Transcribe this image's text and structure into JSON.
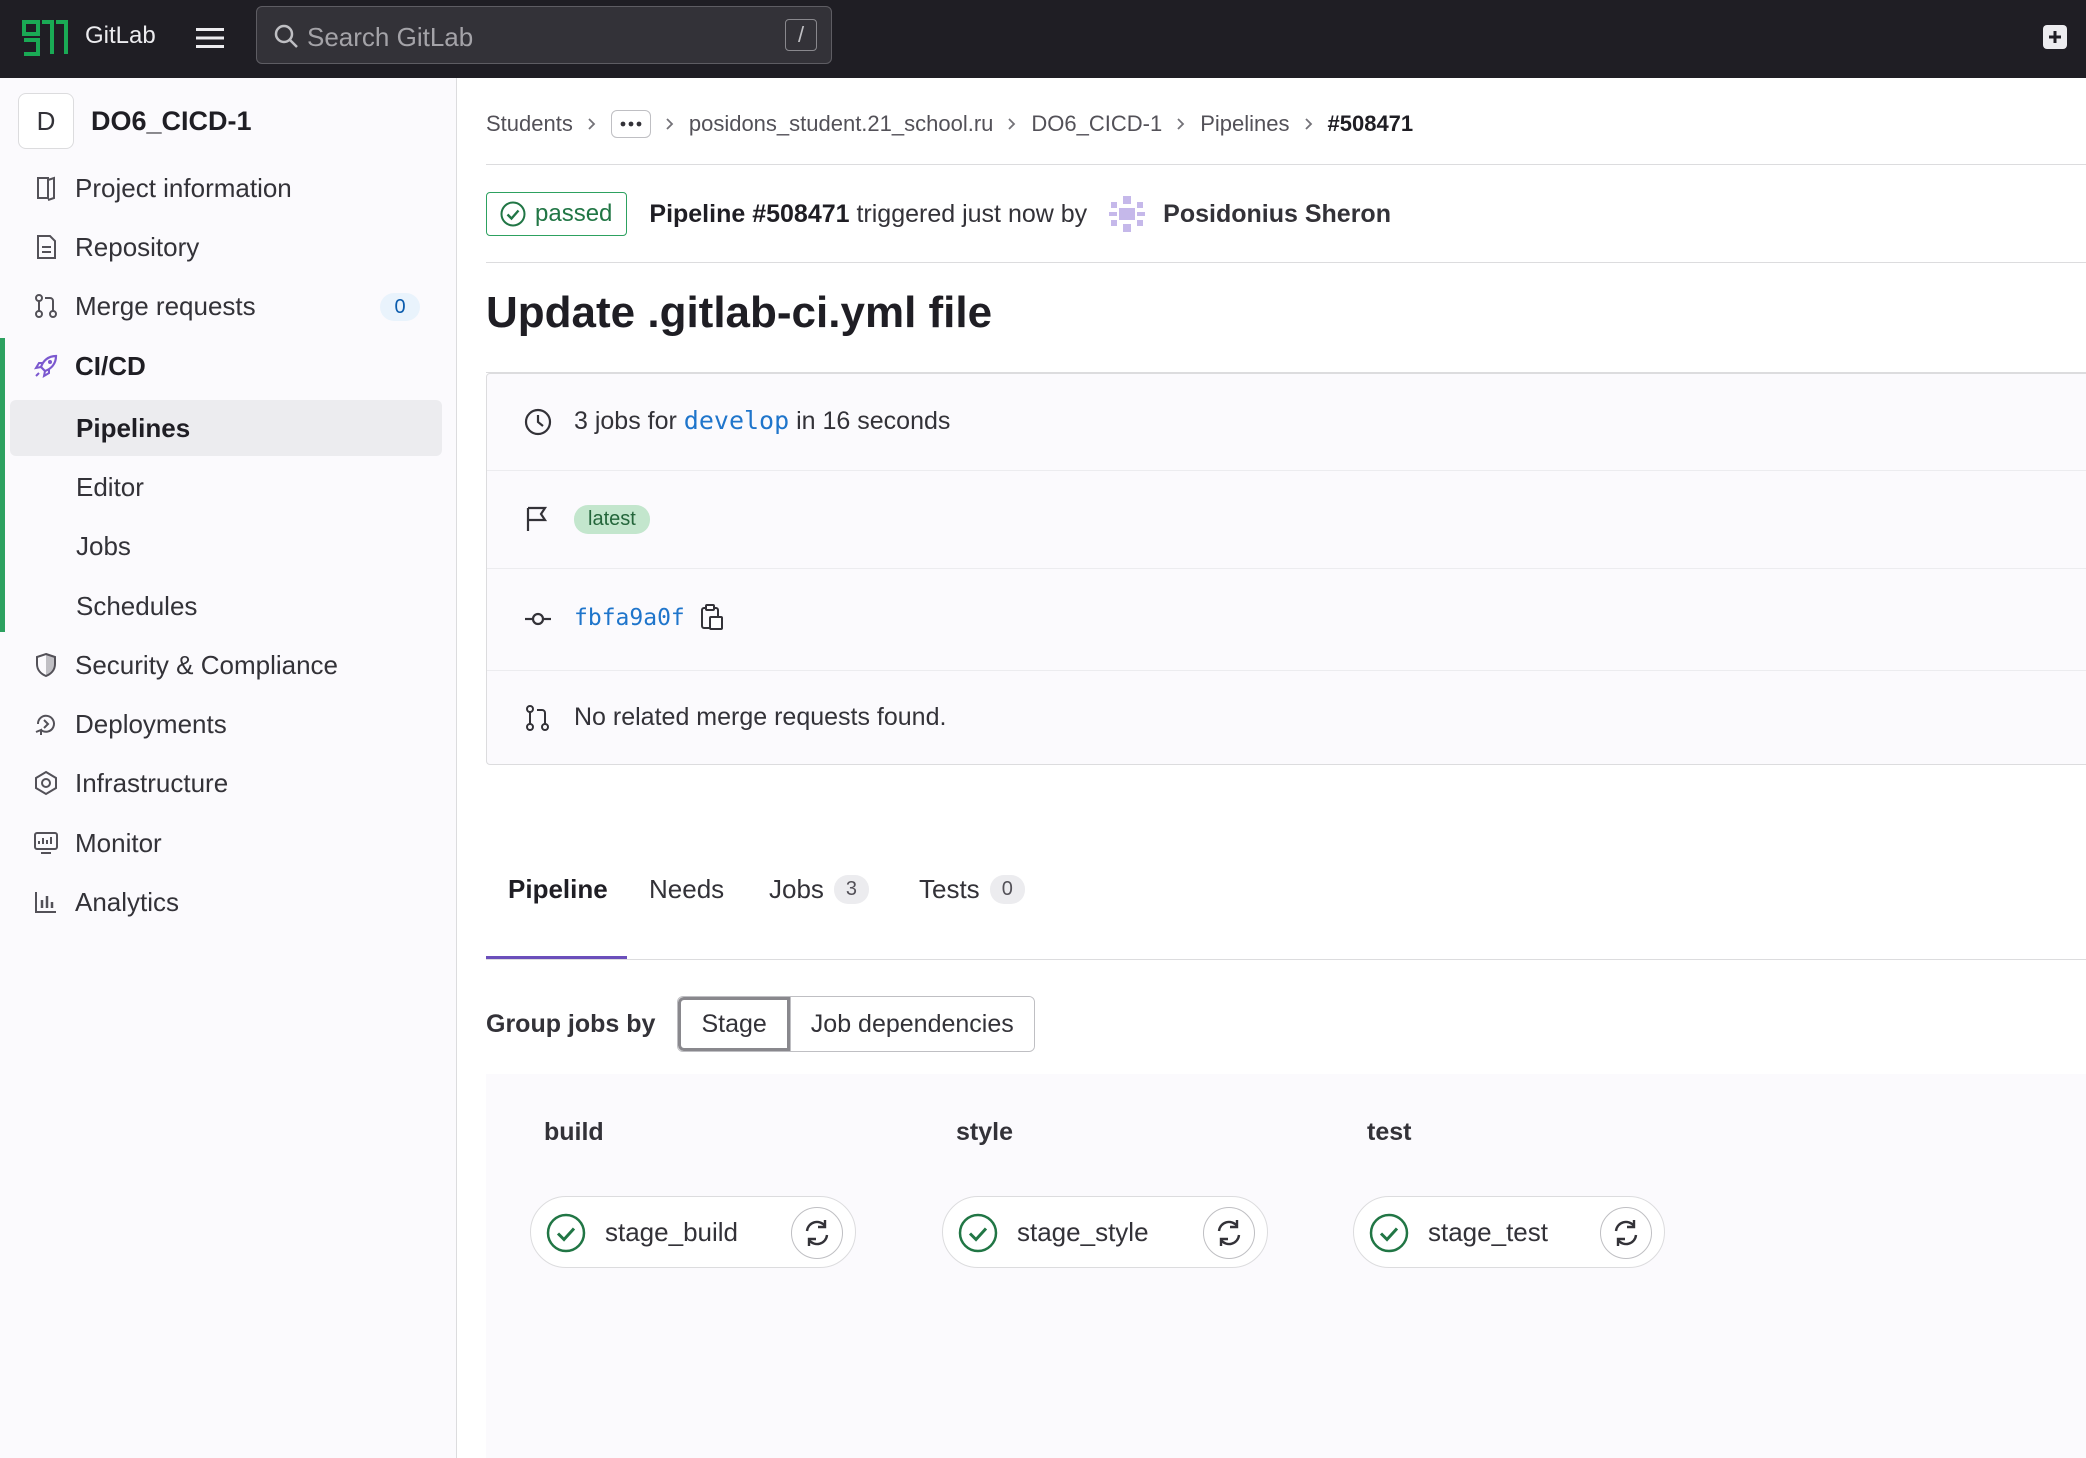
{
  "topbar": {
    "brand": "GitLab",
    "search_placeholder": "Search GitLab",
    "search_shortcut": "/"
  },
  "sidebar": {
    "project_initial": "D",
    "project_name": "DO6_CICD-1",
    "items": [
      {
        "label": "Project information",
        "icon": "project-information-icon"
      },
      {
        "label": "Repository",
        "icon": "repository-icon"
      },
      {
        "label": "Merge requests",
        "icon": "merge-request-icon",
        "count": "0"
      },
      {
        "label": "CI/CD",
        "icon": "rocket-icon"
      },
      {
        "label": "Pipelines"
      },
      {
        "label": "Editor"
      },
      {
        "label": "Jobs"
      },
      {
        "label": "Schedules"
      },
      {
        "label": "Security & Compliance",
        "icon": "shield-icon"
      },
      {
        "label": "Deployments",
        "icon": "deployments-icon"
      },
      {
        "label": "Infrastructure",
        "icon": "infrastructure-icon"
      },
      {
        "label": "Monitor",
        "icon": "monitor-icon"
      },
      {
        "label": "Analytics",
        "icon": "analytics-icon"
      }
    ]
  },
  "breadcrumb": {
    "items": [
      "Students",
      "posidons_student.21_school.ru",
      "DO6_CICD-1",
      "Pipelines"
    ],
    "current": "#508471"
  },
  "pipeline": {
    "status": "passed",
    "id_text": "Pipeline #508471",
    "triggered_text": "triggered just now by",
    "user": "Posidonius Sheron",
    "commit_title": "Update .gitlab-ci.yml file",
    "jobs_prefix": "3 jobs for",
    "branch": "develop",
    "duration": "in 16 seconds",
    "tag": "latest",
    "sha": "fbfa9a0f",
    "mr_text": "No related merge requests found."
  },
  "tabs": [
    {
      "label": "Pipeline"
    },
    {
      "label": "Needs"
    },
    {
      "label": "Jobs",
      "count": "3"
    },
    {
      "label": "Tests",
      "count": "0"
    }
  ],
  "group_by": {
    "label": "Group jobs by",
    "options": [
      "Stage",
      "Job dependencies"
    ],
    "selected": "Stage"
  },
  "stages": [
    {
      "name": "build",
      "job": "stage_build",
      "status": "success"
    },
    {
      "name": "style",
      "job": "stage_style",
      "status": "success"
    },
    {
      "name": "test",
      "job": "stage_test",
      "status": "success"
    }
  ],
  "colors": {
    "topbar": "#1f1e24",
    "success": "#217645",
    "link": "#1f75cb",
    "tab_active": "#6b4fbb"
  }
}
